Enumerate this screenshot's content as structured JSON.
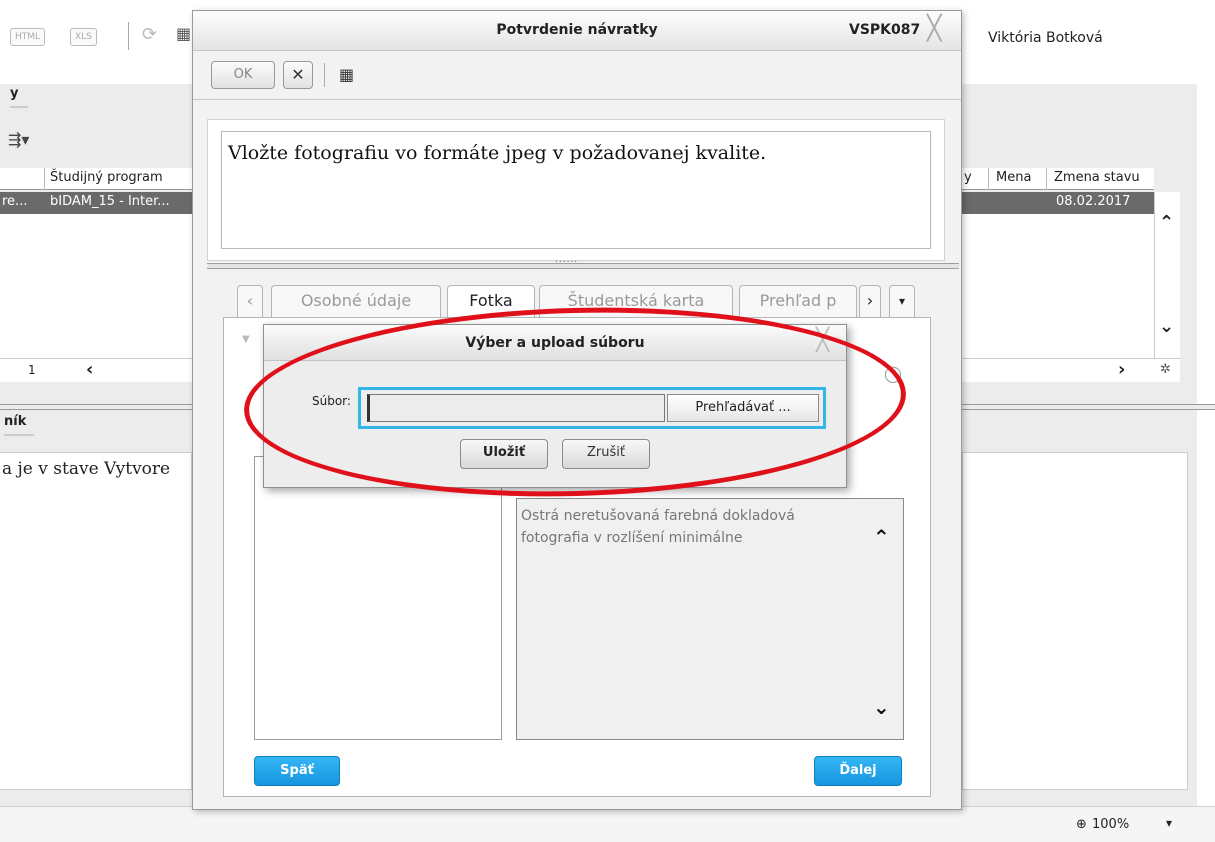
{
  "background": {
    "format_buttons": [
      "HTML",
      "XLS"
    ],
    "user_name": "Viktória Botková",
    "section_top_title": "y",
    "section_bottom_title": "ník",
    "grid": {
      "headers": [
        "Študijný program",
        "y",
        "Mena",
        "Zmena stavu"
      ],
      "row": {
        "c1": "re...",
        "c2": "bIDAM_15 - Inter...",
        "date": "08.02.2017"
      }
    },
    "pager_value": "1",
    "bottom_text": "a je v stave Vytvore",
    "zoom": "100%"
  },
  "dialog": {
    "title": "Potvrdenie návratky",
    "code": "VSPK087",
    "ok_label": "OK",
    "message": "Vložte fotografiu vo formáte jpeg v požadovanej kvalite.",
    "splitter_dots": "......",
    "tabs": [
      "Osobné údaje",
      "Fotka",
      "Študentská karta",
      "Prehľad p"
    ],
    "description": "Ostrá neretušovaná farebná dokladová fotografia v rozlíšení minimálne",
    "back_label": "Späť",
    "next_label": "Ďalej"
  },
  "upload": {
    "title": "Výber a upload súboru",
    "file_label": "Súbor:",
    "file_value": "",
    "browse_label": "Prehľadávať ...",
    "save_label": "Uložiť",
    "cancel_label": "Zrušiť"
  },
  "colors": {
    "accent_blue": "#1796e0",
    "annotation_red": "#e0101a",
    "selected_row": "#6a6a6a"
  }
}
